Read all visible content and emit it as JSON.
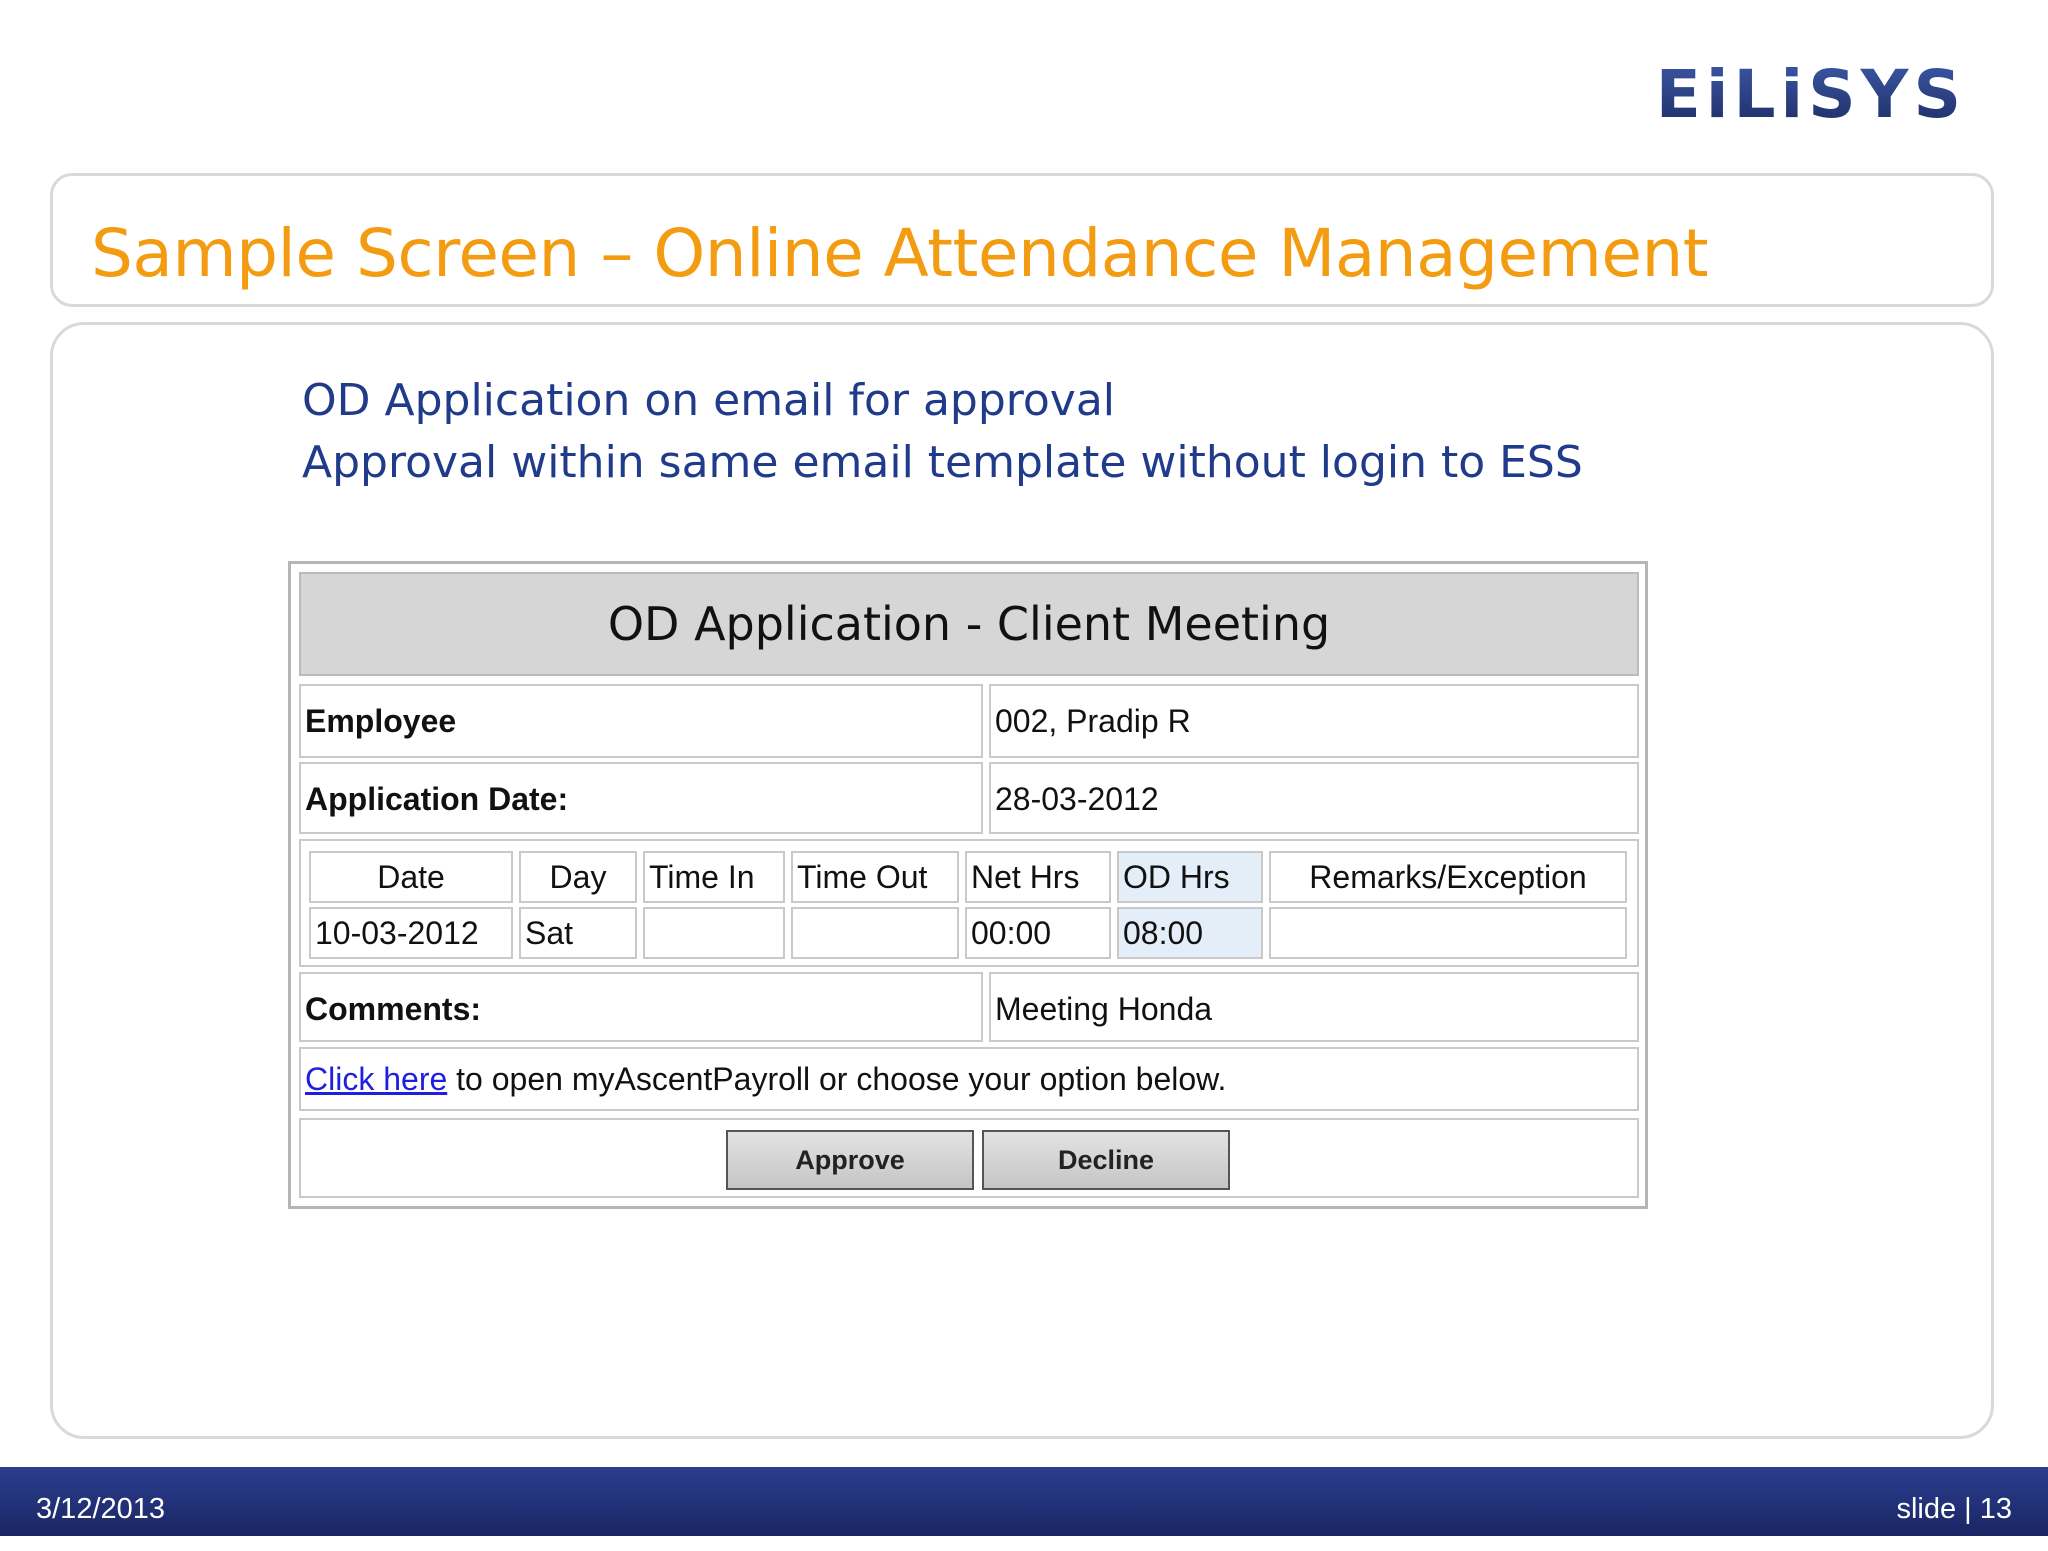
{
  "brand": {
    "logo_text": "EiLiSYS"
  },
  "slide": {
    "title": "Sample Screen – Online Attendance Management",
    "bullets": [
      "OD Application on email for approval",
      "Approval within same email template without login to ESS"
    ]
  },
  "email": {
    "header": "OD Application - Client Meeting",
    "employee_label": "Employee",
    "employee_value": "002, Pradip R",
    "app_date_label": "Application Date:",
    "app_date_value": "28-03-2012",
    "table": {
      "headers": [
        "Date",
        "Day",
        "Time In",
        "Time Out",
        "Net Hrs",
        "OD Hrs",
        "Remarks/Exception"
      ],
      "row": [
        "10-03-2012",
        "Sat",
        "",
        "",
        "00:00",
        "08:00",
        ""
      ]
    },
    "comments_label": "Comments:",
    "comments_value": "Meeting Honda",
    "link_text": "Click here",
    "link_suffix": " to open myAscentPayroll or choose your option below.",
    "approve_label": "Approve",
    "decline_label": "Decline"
  },
  "footer": {
    "date": "3/12/2013",
    "slide_number": "slide | 13"
  }
}
